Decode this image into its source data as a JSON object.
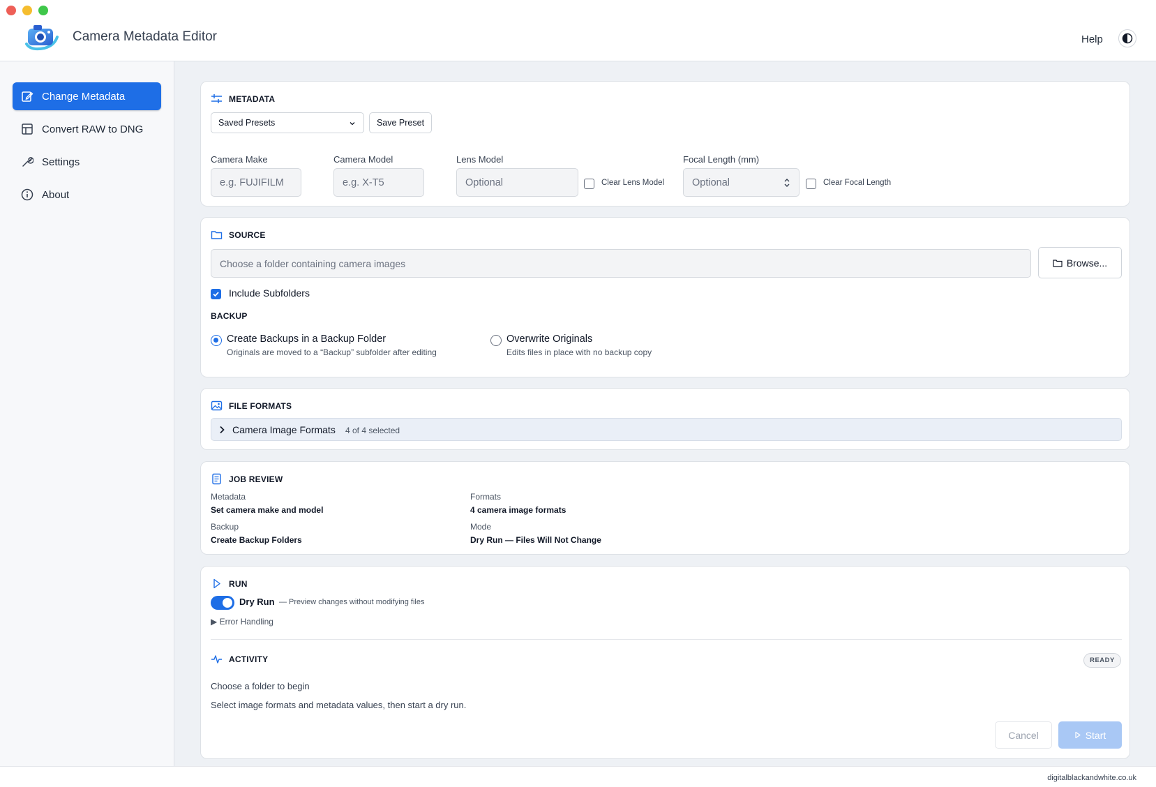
{
  "app": {
    "title": "Camera Metadata Editor",
    "help_label": "Help",
    "footer": "digitalblackandwhite.co.uk"
  },
  "sidebar": {
    "items": [
      {
        "label": "Change Metadata",
        "icon": "edit-icon",
        "active": true
      },
      {
        "label": "Convert RAW to DNG",
        "icon": "table-icon",
        "active": false
      },
      {
        "label": "Settings",
        "icon": "wrench-icon",
        "active": false
      },
      {
        "label": "About",
        "icon": "info-icon",
        "active": false
      }
    ]
  },
  "metadata": {
    "title": "METADATA",
    "presets_value": "Saved Presets",
    "save_preset_label": "Save Preset",
    "camera_make": {
      "label": "Camera Make",
      "placeholder": "e.g. FUJIFILM"
    },
    "camera_model": {
      "label": "Camera Model",
      "placeholder": "e.g. X-T5"
    },
    "lens_model": {
      "label": "Lens Model",
      "placeholder": "Optional",
      "clear_label": "Clear Lens Model"
    },
    "focal_length": {
      "label": "Focal Length (mm)",
      "placeholder": "Optional",
      "clear_label": "Clear Focal Length"
    }
  },
  "source": {
    "title": "SOURCE",
    "folder_placeholder": "Choose a folder containing camera images",
    "browse_label": "Browse...",
    "include_subfolders_label": "Include Subfolders",
    "include_subfolders_checked": true,
    "backup_title": "BACKUP",
    "backup_options": [
      {
        "title": "Create Backups in a Backup Folder",
        "desc": "Originals are moved to a “Backup” subfolder after editing",
        "selected": true
      },
      {
        "title": "Overwrite Originals",
        "desc": "Edits files in place with no backup copy",
        "selected": false
      }
    ]
  },
  "file_formats": {
    "title": "FILE FORMATS",
    "group_label": "Camera Image Formats",
    "group_count": "4 of 4 selected"
  },
  "job_review": {
    "title": "JOB REVIEW",
    "metadata_label": "Metadata",
    "metadata_value": "Set camera make and model",
    "formats_label": "Formats",
    "formats_value": "4 camera image formats",
    "backup_label": "Backup",
    "backup_value": "Create Backup Folders",
    "mode_label": "Mode",
    "mode_value": "Dry Run — Files Will Not Change"
  },
  "run": {
    "title": "RUN",
    "dry_run_label": "Dry Run",
    "dry_run_desc": "— Preview changes without modifying files",
    "dry_run_on": true,
    "error_handling_label": "▶ Error Handling",
    "activity_title": "ACTIVITY",
    "status_badge": "READY",
    "message_primary": "Choose a folder to begin",
    "message_secondary": "Select image formats and metadata values, then start a dry run.",
    "cancel_label": "Cancel",
    "start_label": "Start"
  },
  "colors": {
    "accent": "#1e6ee6",
    "start_disabled": "#a9c8f5"
  }
}
